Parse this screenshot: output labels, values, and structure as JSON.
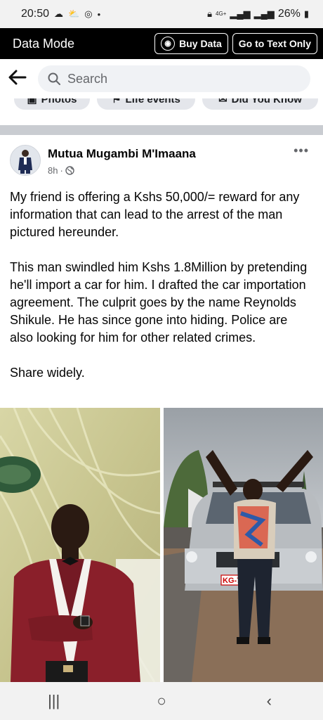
{
  "status_bar": {
    "time": "20:50",
    "network": "4G+",
    "battery": "26%"
  },
  "data_mode": {
    "title": "Data Mode",
    "buy_label": "Buy Data",
    "text_only_label": "Go to Text Only"
  },
  "search": {
    "placeholder": "Search"
  },
  "chips": [
    "Photos",
    "Life events",
    "Did You Know"
  ],
  "post": {
    "author": "Mutua Mugambi M'Imaana",
    "time": "8h",
    "more": "•••",
    "text": "My friend is offering a Kshs 50,000/= reward for any information that can lead to the arrest of the man pictured hereunder.\n\nThis man swindled him Kshs 1.8Million by pretending he'll import a car for him. I drafted the car importation agreement. The culprit goes by the name Reynolds Shikule. He has since gone into hiding. Police are also looking for him for other related crimes.\n\nShare widely.",
    "plate_text": "KG-7"
  },
  "navbar": {
    "recents": "|||",
    "home": "○",
    "back": "‹"
  }
}
